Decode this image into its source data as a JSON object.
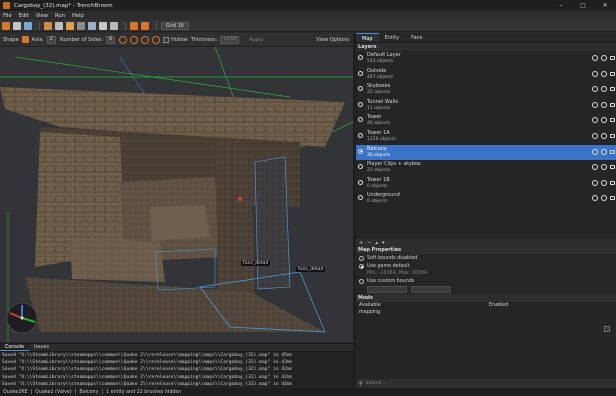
{
  "window": {
    "title": "Cargobay_(32).map* - TrenchBroom",
    "controls": [
      "–",
      "□",
      "✕"
    ]
  },
  "menu": [
    "File",
    "Edit",
    "View",
    "Run",
    "Help"
  ],
  "toolbar": {
    "grid_label": "Grid 16"
  },
  "shape_bar": {
    "shape_label": "Shape",
    "axis_label": "Axis:",
    "axis_value": "Z",
    "sides_label": "Number of Sides:",
    "sides_value": "8",
    "hollow_label": "Hollow",
    "thickness_label": "Thickness:",
    "thickness_value": "16.00",
    "apply_label": "Apply",
    "view_options_label": "View Options"
  },
  "viewport": {
    "labels": [
      "func_detail",
      "func_detail"
    ]
  },
  "console": {
    "tabs": [
      "Console",
      "Issues"
    ],
    "lines": [
      "Saved \"X:\\\\SteamLibrary\\\\steamapps\\\\common\\\\Quake 2\\\\rerelease\\\\mapping\\\\maps\\\\Cargobay_(32).map\" in 45ms",
      "Saved \"X:\\\\SteamLibrary\\\\steamapps\\\\common\\\\Quake 2\\\\rerelease\\\\mapping\\\\maps\\\\Cargobay_(32).map\" in 43ms",
      "Saved \"X:\\\\SteamLibrary\\\\steamapps\\\\common\\\\Quake 2\\\\rerelease\\\\mapping\\\\maps\\\\Cargobay_(32).map\" in 42ms",
      "Saved \"X:\\\\SteamLibrary\\\\steamapps\\\\common\\\\Quake 2\\\\rerelease\\\\mapping\\\\maps\\\\Cargobay_(32).map\" in 42ms",
      "Saved \"X:\\\\SteamLibrary\\\\steamapps\\\\common\\\\Quake 2\\\\rerelease\\\\mapping\\\\maps\\\\Cargobay_(32).map\" in 44ms"
    ]
  },
  "status": {
    "game": "Quake2KE",
    "sep": "|",
    "profile": "Quake2 (Valve)",
    "layer": "Balcony",
    "info": "1 entity and 22 brushes hidden"
  },
  "right_panel": {
    "tabs": [
      "Map",
      "Entity",
      "Face"
    ],
    "layers_header": "Layers",
    "layers": [
      {
        "name": "Default Layer",
        "count": "543 objects",
        "selected": false,
        "current": false
      },
      {
        "name": "Outside",
        "count": "487 objects",
        "selected": false,
        "current": false
      },
      {
        "name": "Skyboxes",
        "count": "25 objects",
        "selected": false,
        "current": false
      },
      {
        "name": "Tunnel Walls",
        "count": "11 objects",
        "selected": false,
        "current": false
      },
      {
        "name": "Tower",
        "count": "46 objects",
        "selected": false,
        "current": false
      },
      {
        "name": "Tower 1A",
        "count": "1226 objects",
        "selected": false,
        "current": false
      },
      {
        "name": "Balcony",
        "count": "30 objects",
        "selected": true,
        "current": true
      },
      {
        "name": "Player Clips + skybox",
        "count": "22 objects",
        "selected": false,
        "current": false
      },
      {
        "name": "Tower 1B",
        "count": "0 objects",
        "selected": false,
        "current": false
      },
      {
        "name": "Underground",
        "count": "0 objects",
        "selected": false,
        "current": false
      }
    ],
    "layer_toolbar": [
      "+",
      "−",
      "▴",
      "▾"
    ],
    "map_props_header": "Map Properties",
    "soft_bounds_label": "Soft bounds disabled",
    "game_default_label": "Use game default",
    "game_default_detail": "Min: -16384, Max: 16384",
    "custom_bounds_label": "Use custom bounds",
    "mods_header": "Mods",
    "mods_available": "Available",
    "mods_enabled": "Enabled",
    "mods_items": [
      "mapping"
    ],
    "mods_search_placeholder": "Search..."
  },
  "colors": {
    "selection": "#3a74c9",
    "accent": "#d8752a"
  }
}
